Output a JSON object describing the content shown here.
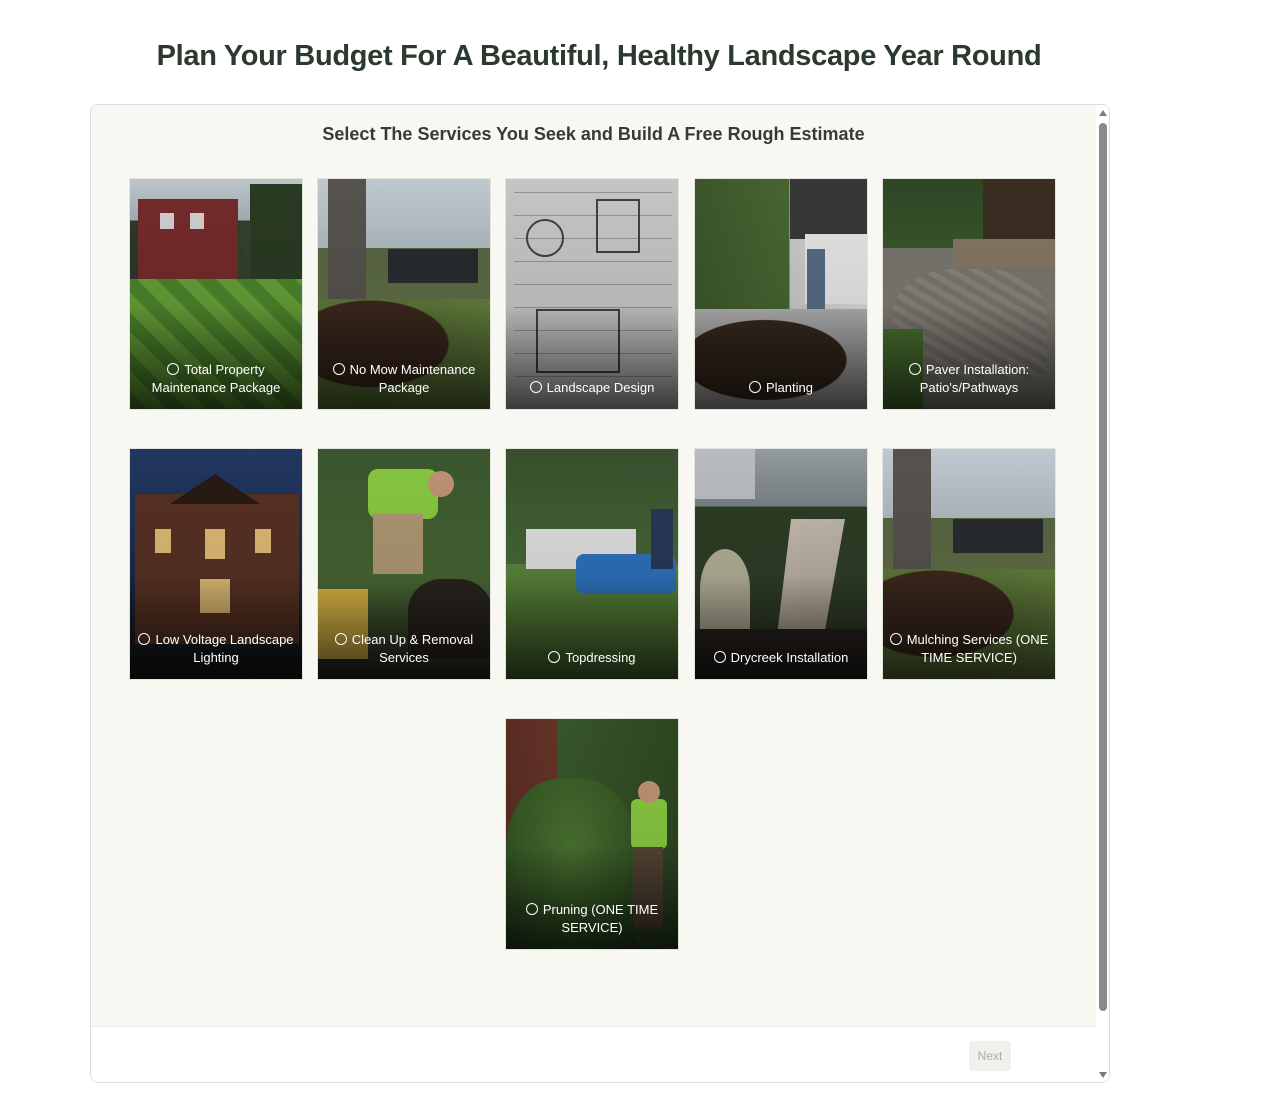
{
  "page": {
    "title": "Plan Your Budget For A Beautiful, Healthy Landscape Year Round"
  },
  "form": {
    "heading": "Select The Services You Seek and Build A Free Rough Estimate",
    "next_label": "Next"
  },
  "services": [
    {
      "label": "Total Property Maintenance Package",
      "selected": false
    },
    {
      "label": "No Mow Maintenance Package",
      "selected": false
    },
    {
      "label": "Landscape Design",
      "selected": false
    },
    {
      "label": "Planting",
      "selected": false
    },
    {
      "label": "Paver Installation: Patio's/Pathways",
      "selected": false
    },
    {
      "label": "Low Voltage Landscape Lighting",
      "selected": false
    },
    {
      "label": "Clean Up & Removal Services",
      "selected": false
    },
    {
      "label": "Topdressing",
      "selected": false
    },
    {
      "label": "Drycreek Installation",
      "selected": false
    },
    {
      "label": "Mulching Services (ONE TIME SERVICE)",
      "selected": false
    },
    {
      "label": "Pruning (ONE TIME SERVICE)",
      "selected": false
    }
  ],
  "colors": {
    "title": "#2b3a2e",
    "panel_bg": "#f7f8f1",
    "next_bg": "#eef1ec"
  }
}
